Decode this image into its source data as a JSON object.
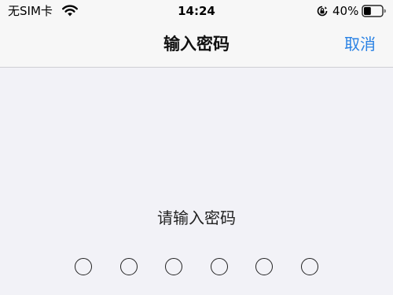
{
  "status_bar": {
    "carrier": "无SIM卡",
    "time": "14:24",
    "battery_percent": "40%",
    "battery_level": 0.4
  },
  "nav": {
    "title": "输入密码",
    "cancel_label": "取消"
  },
  "prompt": "请输入密码",
  "passcode": {
    "length": 6,
    "entered": 0
  },
  "colors": {
    "accent": "#2a82e4",
    "background": "#f2f2f7"
  },
  "icons": [
    "wifi-icon",
    "orientation-lock-icon",
    "battery-icon"
  ]
}
